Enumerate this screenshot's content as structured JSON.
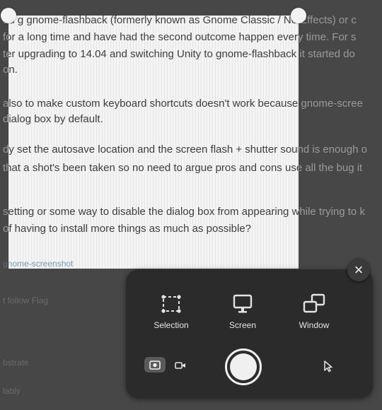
{
  "background_text": {
    "lines": [
      "au  g gnome-flashback (formerly known as Gnome Classic / No Effects) or c",
      "for a long time and have had the second outcome happen every time. For s",
      "ter upgrading to 14.04 and switching Unity to gnome-flashback it started do",
      "on.",
      "also to make custom keyboard shortcuts doesn't work because gnome-scree",
      "dialog box by default.",
      "dy set the autosave location and the screen flash + shutter sound is enough o",
      "that a shot's been taken so no need to argue pros and cons   use all the bug it",
      "  setting or some way to disable the dialog box from appearing while trying to k",
      "of having to install more things as much as possible?",
      "gnome-screenshot",
      "t   follow   Flag",
      "bstrate",
      "lably"
    ]
  },
  "toolbar": {
    "close_label": "×",
    "modes": [
      {
        "label": "Selection",
        "icon": "selection-icon"
      },
      {
        "label": "Screen",
        "icon": "screen-icon"
      },
      {
        "label": "Window",
        "icon": "window-icon"
      }
    ],
    "capture_toggle": {
      "screenshot_icon": "camera-icon",
      "screencast_icon": "video-icon",
      "active": "screenshot"
    },
    "shutter_icon": "shutter-icon",
    "pointer_icon": "pointer-icon"
  }
}
